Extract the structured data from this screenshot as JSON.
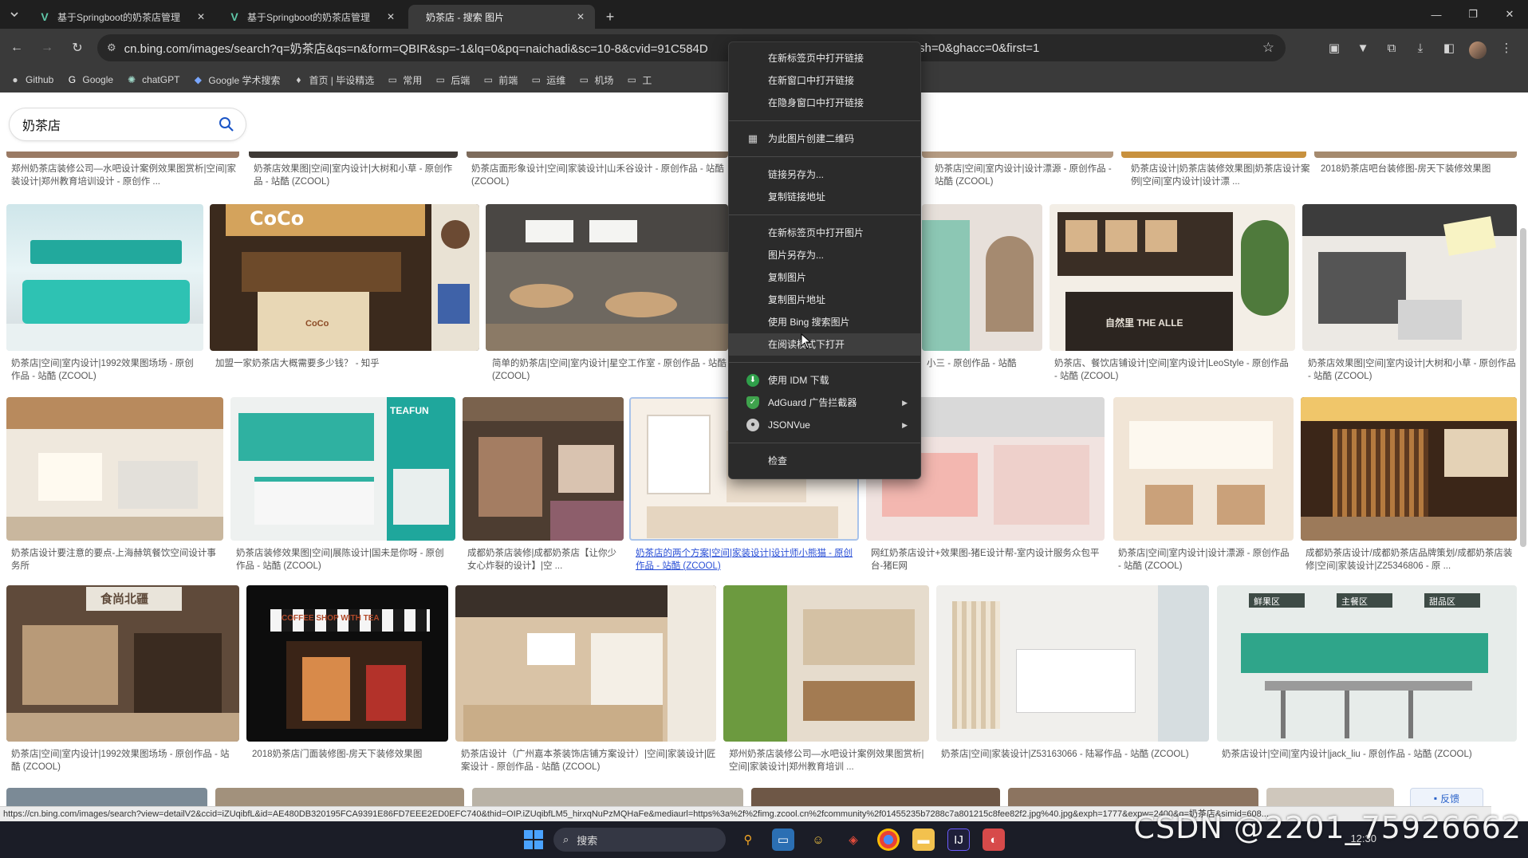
{
  "browser": {
    "tabs": [
      {
        "title": "基于Springboot的奶茶店管理",
        "active": false
      },
      {
        "title": "基于Springboot的奶茶店管理",
        "active": false
      },
      {
        "title": "奶茶店 - 搜索 图片",
        "active": true
      }
    ],
    "url": "cn.bing.com/images/search?q=奶茶店&qs=n&form=QBIR&sp=-1&lq=0&pq=naichadi&sc=10-8&cvid=91C584D",
    "url_tail": "sh=0&ghacc=0&first=1",
    "bookmarks": [
      {
        "label": "Github",
        "icon": "github-icon"
      },
      {
        "label": "Google",
        "icon": "google-icon"
      },
      {
        "label": "chatGPT",
        "icon": "chatgpt-icon"
      },
      {
        "label": "Google 学术搜索",
        "icon": "scholar-icon"
      },
      {
        "label": "首页 | 毕设精选",
        "icon": "bookmark-icon"
      },
      {
        "label": "常用",
        "icon": "folder-icon"
      },
      {
        "label": "后端",
        "icon": "folder-icon"
      },
      {
        "label": "前端",
        "icon": "folder-icon"
      },
      {
        "label": "运维",
        "icon": "folder-icon"
      },
      {
        "label": "机场",
        "icon": "folder-icon"
      },
      {
        "label": "工",
        "icon": "folder-icon"
      }
    ]
  },
  "search": {
    "query": "奶茶店"
  },
  "top_captions": [
    "郑州奶茶店装修公司—水吧设计案例效果图赏析|空间|家装设计|郑州教育培训设计 - 原创作 ...",
    "奶茶店效果图|空间|室内设计|大树和小草 - 原创作品 - 站酷 (ZCOOL)",
    "奶茶店面形象设计|空间|家装设计|山禾谷设计 - 原创作品 - 站酷 (ZCOOL)",
    "奶茶店|空间|室内设计|设计漂源 - 原创作品 - 站酷 (ZCOOL)",
    "奶茶店设计|奶茶店装修效果图|奶茶店设计案例|空间|室内设计|设计漂 ...",
    "2018奶茶店吧台装修图-房天下装修效果图"
  ],
  "row1_captions": [
    "奶茶店|空间|室内设计|1992效果图场场 - 原创作品 - 站酷 (ZCOOL)",
    "加盟一家奶茶店大概需要多少钱？ - 知乎",
    "简单的奶茶店|空间|室内设计|星空工作室 - 原创作品 - 站酷 (ZCOOL)",
    "小三 - 原创作品 - 站酷",
    "奶茶店、餐饮店铺设计|空间|室内设计|LeoStyle - 原创作品 - 站酷 (ZCOOL)",
    "奶茶店效果图|空间|室内设计|大树和小草 - 原创作品 - 站酷 (ZCOOL)"
  ],
  "row2_captions": [
    "奶茶店设计要注意的要点-上海赫筑餐饮空间设计事务所",
    "奶茶店装修效果图|空间|展陈设计|国未是你呀 - 原创作品 - 站酷 (ZCOOL)",
    "成都奶茶店装修|成都奶茶店【让你少女心炸裂的设计】|空 ...",
    "奶茶店的两个方案|空间|家装设计|设计师小熊猫 - 原创作品 - 站酷 (ZCOOL)",
    "网红奶茶店设计+效果图-猪E设计帮-室内设计服务众包平台-猪E网",
    "奶茶店|空间|室内设计|设计漂源 - 原创作品 - 站酷 (ZCOOL)",
    "成都奶茶店设计/成都奶茶店品牌策划/成都奶茶店装修|空间|家装设计|Z25346806 - 原 ..."
  ],
  "row3_captions": [
    "奶茶店|空间|室内设计|1992效果图场场 - 原创作品 - 站酷 (ZCOOL)",
    "2018奶茶店门面装修图-房天下装修效果图",
    "奶茶店设计（广州嘉本茶装饰店铺方案设计）|空间|家装设计|匠案设计 - 原创作品 - 站酷 (ZCOOL)",
    "郑州奶茶店装修公司—水吧设计案例效果图赏析|空间|家装设计|郑州教育培训 ...",
    "奶茶店|空间|家装设计|Z53163066 - 陆幂作品 - 站酷 (ZCOOL)",
    "奶茶店设计|空间|室内设计|jack_liu - 原创作品 - 站酷 (ZCOOL)"
  ],
  "tile_texts": {
    "coco_sign": "CoCo",
    "coco_counter": "CoCo",
    "leestyle_sign": "自然里 THE ALLE",
    "teafun_sign": "TEAFUN",
    "shangbei_sign": "食尚北疆",
    "awning_sign": "COFFEE SHOP WITH TEA",
    "menu_board_1": "鲜果区",
    "menu_board_2": "主餐区",
    "menu_board_3": "甜品区"
  },
  "context_menu": {
    "items": [
      {
        "label": "在新标签页中打开链接",
        "group": 1
      },
      {
        "label": "在新窗口中打开链接",
        "group": 1
      },
      {
        "label": "在隐身窗口中打开链接",
        "group": 1
      },
      {
        "label": "为此图片创建二维码",
        "group": 2,
        "icon": "qr-code-icon"
      },
      {
        "label": "链接另存为...",
        "group": 3
      },
      {
        "label": "复制链接地址",
        "group": 3
      },
      {
        "label": "在新标签页中打开图片",
        "group": 4
      },
      {
        "label": "图片另存为...",
        "group": 4
      },
      {
        "label": "复制图片",
        "group": 4
      },
      {
        "label": "复制图片地址",
        "group": 4
      },
      {
        "label": "使用 Bing 搜索图片",
        "group": 4
      },
      {
        "label": "在阅读模式下打开",
        "group": 4,
        "hover": true
      },
      {
        "label": "使用 IDM 下载",
        "group": 5,
        "icon": "idm-icon"
      },
      {
        "label": "AdGuard 广告拦截器",
        "group": 5,
        "icon": "adguard-icon",
        "submenu": true
      },
      {
        "label": "JSONVue",
        "group": 5,
        "icon": "jsonvue-icon",
        "submenu": true
      },
      {
        "label": "检查",
        "group": 6
      }
    ]
  },
  "page_footer": {
    "feedback_label": "反馈"
  },
  "status_bar": {
    "hover_url": "https://cn.bing.com/images/search?view=detailV2&ccid=iZUqibfL&id=AE480DB320195FCA9391E86FD7EEE2ED0EFC740&thid=OIP.iZUqibfLM5_hirxqNuPzMQHaFe&mediaurl=https%3a%2f%2fimg.zcool.cn%2fcommunity%2f01455235b7288c7a801215c8fee82f2.jpg%40.jpg&exph=1777&expw=2400&q=奶茶店&simid=608..."
  },
  "taskbar": {
    "search_label": "搜索",
    "clock": "12:30"
  },
  "watermark": "CSDN @2201_75926662",
  "colors": {
    "browser_dark": "#3a3a3a",
    "tab_bar": "#1f1f1f",
    "menu_bg": "#2b2b2b",
    "link_blue": "#2a4fd6",
    "taskbar": "#1b1d27"
  }
}
